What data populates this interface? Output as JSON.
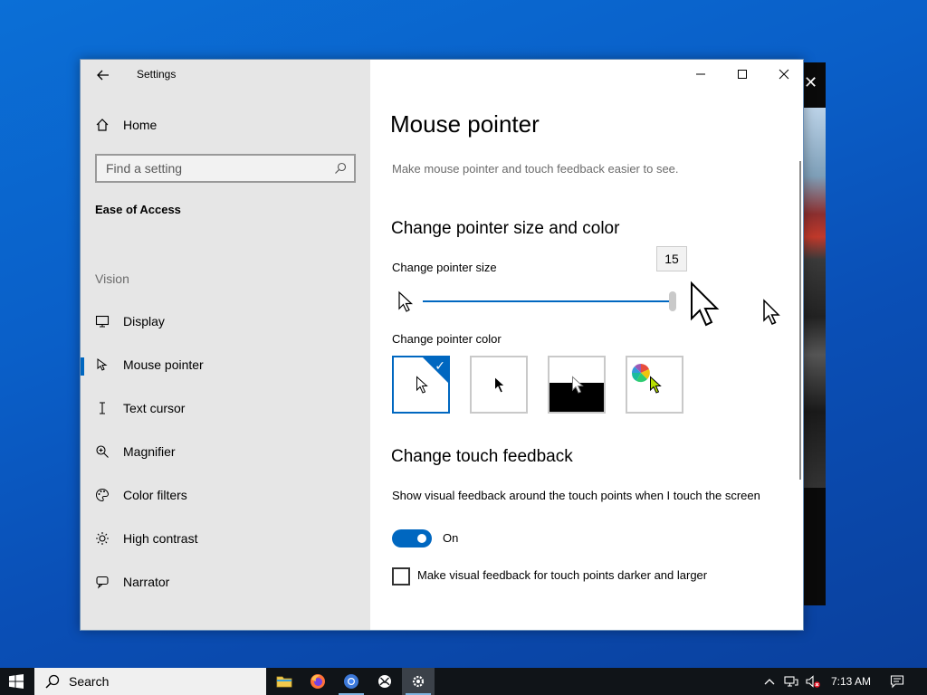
{
  "window": {
    "title": "Settings",
    "minimize_icon": "minimize-icon",
    "maximize_icon": "maximize-icon",
    "close_icon": "close-icon"
  },
  "sidebar": {
    "home_label": "Home",
    "search_placeholder": "Find a setting",
    "category": "Ease of Access",
    "section": "Vision",
    "items": [
      {
        "label": "Display",
        "icon": "display-icon",
        "selected": false
      },
      {
        "label": "Mouse pointer",
        "icon": "mouse-pointer-icon",
        "selected": true
      },
      {
        "label": "Text cursor",
        "icon": "text-cursor-icon",
        "selected": false
      },
      {
        "label": "Magnifier",
        "icon": "magnifier-icon",
        "selected": false
      },
      {
        "label": "Color filters",
        "icon": "palette-icon",
        "selected": false
      },
      {
        "label": "High contrast",
        "icon": "sun-icon",
        "selected": false
      },
      {
        "label": "Narrator",
        "icon": "narrator-icon",
        "selected": false
      }
    ]
  },
  "content": {
    "title": "Mouse pointer",
    "description": "Make mouse pointer and touch feedback easier to see.",
    "size_color_heading": "Change pointer size and color",
    "pointer_size_label": "Change pointer size",
    "pointer_size_value": "15",
    "pointer_color_label": "Change pointer color",
    "color_options": [
      "white",
      "black",
      "inverted",
      "custom"
    ],
    "selected_color": "white",
    "touch_heading": "Change touch feedback",
    "touch_show_label": "Show visual feedback around the touch points when I touch the screen",
    "touch_toggle_state": "On",
    "darker_label": "Make visual feedback for touch points darker and larger",
    "darker_checked": false
  },
  "taskbar": {
    "search_label": "Search",
    "apps": [
      "file-explorer-icon",
      "firefox-icon",
      "chrome-icon",
      "xbox-icon",
      "settings-icon"
    ],
    "time": "7:13 AM"
  },
  "colors": {
    "accent": "#0067c0",
    "sidebar_bg": "#e6e6e6",
    "taskbar_bg": "#101418"
  }
}
